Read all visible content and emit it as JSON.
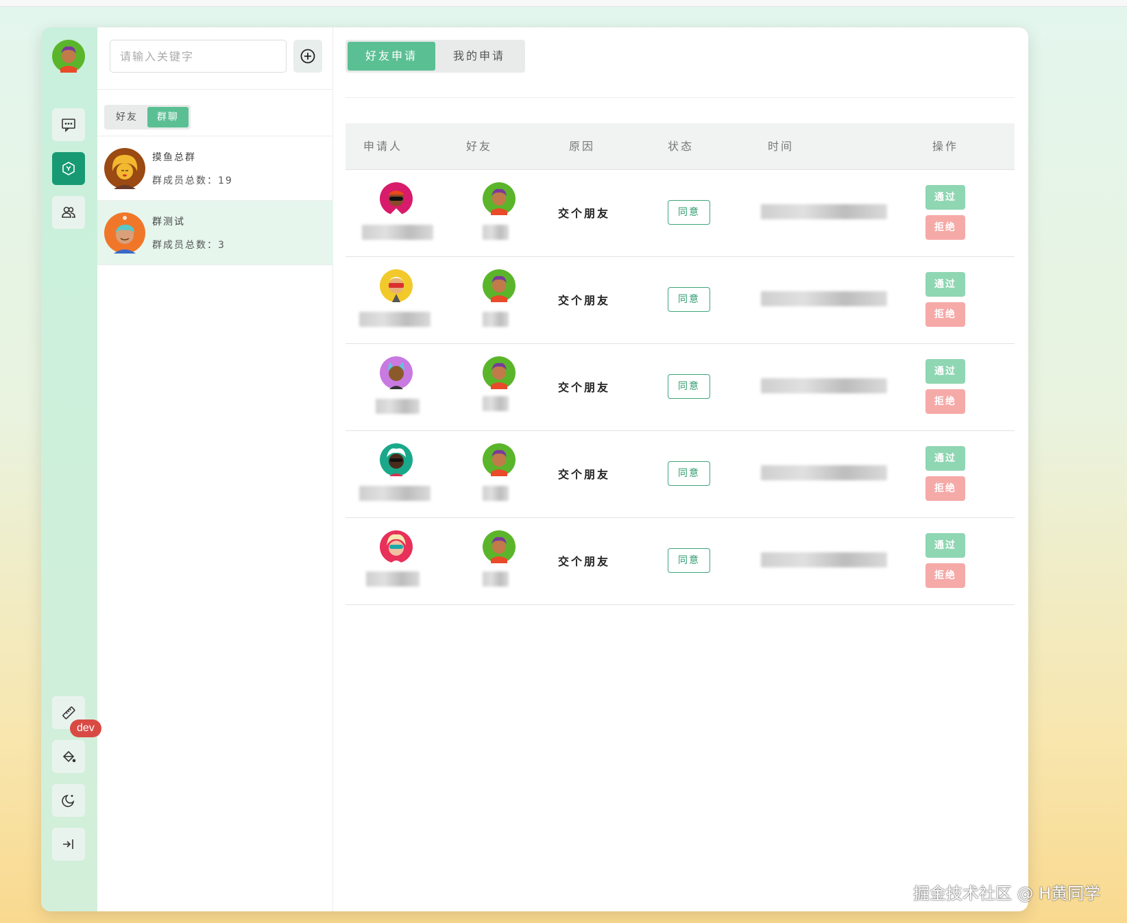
{
  "search": {
    "placeholder": "请输入关键字"
  },
  "list_tabs": {
    "friends": "好友",
    "groups": "群聊"
  },
  "groups": [
    {
      "name": "摸鱼总群",
      "count_label": "群成员总数：19"
    },
    {
      "name": "群测试",
      "count_label": "群成员总数：3"
    }
  ],
  "main_tabs": {
    "friend_requests": "好友申请",
    "my_requests": "我的申请"
  },
  "table": {
    "headers": [
      "申请人",
      "好友",
      "原因",
      "状态",
      "时间",
      "操作"
    ],
    "rows": [
      {
        "reason": "交个朋友",
        "status": "同意",
        "approve": "通过",
        "reject": "拒绝",
        "applicant_avatar": "avatar-red-sunglasses-icon",
        "friend_avatar": "avatar-green-purple-hair-icon"
      },
      {
        "reason": "交个朋友",
        "status": "同意",
        "approve": "通过",
        "reject": "拒绝",
        "applicant_avatar": "avatar-yellow-vr-icon",
        "friend_avatar": "avatar-green-purple-hair-icon"
      },
      {
        "reason": "交个朋友",
        "status": "同意",
        "approve": "通过",
        "reject": "拒绝",
        "applicant_avatar": "avatar-purple-cat-ears-icon",
        "friend_avatar": "avatar-green-purple-hair-icon"
      },
      {
        "reason": "交个朋友",
        "status": "同意",
        "approve": "通过",
        "reject": "拒绝",
        "applicant_avatar": "avatar-teal-white-hair-icon",
        "friend_avatar": "avatar-green-purple-hair-icon"
      },
      {
        "reason": "交个朋友",
        "status": "同意",
        "approve": "通过",
        "reject": "拒绝",
        "applicant_avatar": "avatar-pink-visor-icon",
        "friend_avatar": "avatar-green-purple-hair-icon"
      }
    ]
  },
  "badge": {
    "dev": "dev"
  },
  "watermark": "掘金技术社区 @ H黄同学",
  "colors": {
    "accent": "#5bbf94",
    "active_rail": "#179a73",
    "approve": "#8fd6b3",
    "reject": "#f5aaa8",
    "badge": "#d94a45"
  }
}
